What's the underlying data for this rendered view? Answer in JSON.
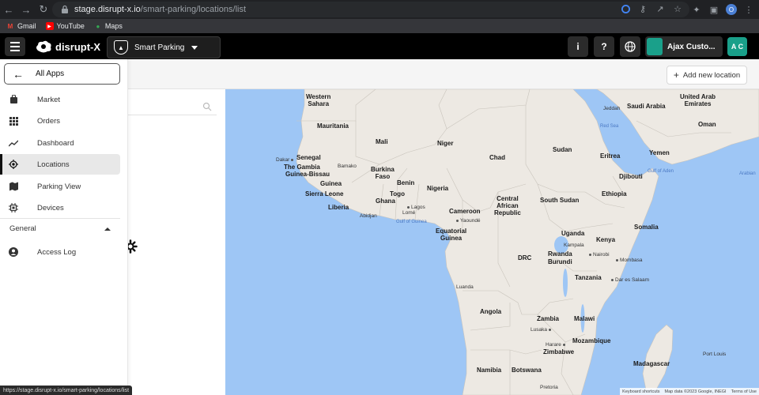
{
  "browser": {
    "url_host": "stage.disrupt-x.io",
    "url_path": "/smart-parking/locations/list",
    "profile_initial": "O",
    "bookmarks": [
      {
        "label": "Gmail",
        "icon": "gmail-icon"
      },
      {
        "label": "YouTube",
        "icon": "youtube-icon"
      },
      {
        "label": "Maps",
        "icon": "maps-icon"
      }
    ],
    "status_url": "https://stage.disrupt-x.io/smart-parking/locations/list"
  },
  "header": {
    "logo_text": "disrupt-X",
    "app_name": "Smart Parking",
    "org_name": "Ajax Custo...",
    "avatar_initials": "A C",
    "accent": "#1aa08a"
  },
  "sidebar": {
    "back_label": "All Apps",
    "items": [
      {
        "label": "Market",
        "icon": "bag-icon"
      },
      {
        "label": "Orders",
        "icon": "grid-icon"
      },
      {
        "label": "Dashboard",
        "icon": "trend-icon"
      },
      {
        "label": "Locations",
        "icon": "target-icon",
        "active": true
      },
      {
        "label": "Parking View",
        "icon": "map-icon"
      },
      {
        "label": "Devices",
        "icon": "chip-icon"
      }
    ],
    "section_label": "General",
    "section_items": [
      {
        "label": "Access Log",
        "icon": "person-icon"
      }
    ]
  },
  "toolbar": {
    "add_location_label": "Add new location"
  },
  "map": {
    "labels": {
      "western_sahara": "Western\nSahara",
      "mauritania": "Mauritania",
      "mali": "Mali",
      "niger": "Niger",
      "chad": "Chad",
      "sudan": "Sudan",
      "senegal": "Senegal",
      "dakar": "Dakar",
      "gambia": "The Gambia",
      "guinea_bissau": "Guinea-Bissau",
      "bamako": "Bamako",
      "burkina": "Burkina\nFaso",
      "guinea": "Guinea",
      "benin": "Benin",
      "nigeria": "Nigeria",
      "sierra_leone": "Sierra Leone",
      "togo": "Togo",
      "ghana": "Ghana",
      "liberia": "Liberia",
      "lagos": "Lagos",
      "abidjan": "Abidjan",
      "lome": "Lomé",
      "cameroon": "Cameroon",
      "car": "Central\nAfrican\nRepublic",
      "south_sudan": "South Sudan",
      "ethiopia": "Ethiopia",
      "eritrea": "Eritrea",
      "djibouti": "Djibouti",
      "yemen": "Yemen",
      "jeddah": "Jeddah",
      "saudi": "Saudi Arabia",
      "uae": "United Arab\nEmirates",
      "oman": "Oman",
      "red_sea": "Red Sea",
      "gulf_aden": "Gulf of Aden",
      "arabian": "Arabian",
      "gulf_guinea": "Gulf of Guinea",
      "yaounde": "Yaoundé",
      "eq_guinea": "Equatorial\nGuinea",
      "uganda": "Uganda",
      "kenya": "Kenya",
      "somalia": "Somalia",
      "kampala": "Kampala",
      "nairobi": "Nairobi",
      "rwanda": "Rwanda",
      "burundi": "Burundi",
      "drc": "DRC",
      "mombasa": "Mombasa",
      "tanzania": "Tanzania",
      "dar": "Dar es Salaam",
      "luanda": "Luanda",
      "angola": "Angola",
      "zambia": "Zambia",
      "malawi": "Malawi",
      "lusaka": "Lusaka",
      "harare": "Harare",
      "zimbabwe": "Zimbabwe",
      "mozambique": "Mozambique",
      "namibia": "Namibia",
      "botswana": "Botswana",
      "pretoria": "Pretoria",
      "madagascar": "Madagascar",
      "port_louis": "Port Louis"
    },
    "attribution": [
      "Keyboard shortcuts",
      "Map data ©2023 Google, INEGI",
      "Terms of Use"
    ],
    "land_color": "#ede9e3",
    "water_color": "#9ec6f5"
  }
}
